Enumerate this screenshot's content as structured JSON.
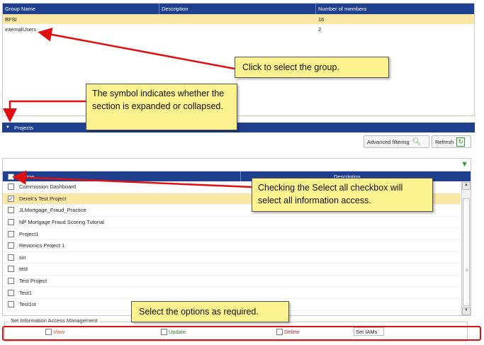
{
  "groups_table": {
    "columns": [
      "Group Name",
      "Description",
      "Number of members"
    ],
    "rows": [
      {
        "name": "BFSI",
        "description": "",
        "members": "16",
        "selected": true
      },
      {
        "name": "internalUsers",
        "description": "",
        "members": "2",
        "selected": false
      }
    ]
  },
  "projects": {
    "section_title": "Projects",
    "toolbar": {
      "advanced_filtering": "Advanced filtering",
      "refresh": "Refresh"
    },
    "columns": {
      "name": "Name",
      "description": "Description"
    },
    "items": [
      {
        "label": "Commission Dashboard",
        "checked": false
      },
      {
        "label": "Derek's Test Project",
        "checked": true
      },
      {
        "label": "JLMortgage_Fraud_Practice",
        "checked": false
      },
      {
        "label": "NP Mortgage Fraud Scoring Tutorial",
        "checked": false
      },
      {
        "label": "Project1",
        "checked": false
      },
      {
        "label": "Revionics Project 1",
        "checked": false
      },
      {
        "label": "sin",
        "checked": false
      },
      {
        "label": "test",
        "checked": false
      },
      {
        "label": "Test Project",
        "checked": false
      },
      {
        "label": "Test1",
        "checked": false
      },
      {
        "label": "Test1st",
        "checked": false
      }
    ]
  },
  "iam": {
    "legend": "Set Information Access Management",
    "view": "View",
    "update": "Update",
    "delete": "Delete",
    "set_button": "Set IAMs"
  },
  "callouts": {
    "select_group": "Click to select the group.",
    "symbol": "The symbol indicates whether the section is expanded or collapsed.",
    "select_all": "Checking the Select all checkbox will select all information access.",
    "options": "Select the options as required."
  },
  "colors": {
    "header_blue": "#1f3f8f",
    "selected_row": "#fbe8a6",
    "callout_yellow": "#fcf28f",
    "arrow_red": "#e01010"
  }
}
